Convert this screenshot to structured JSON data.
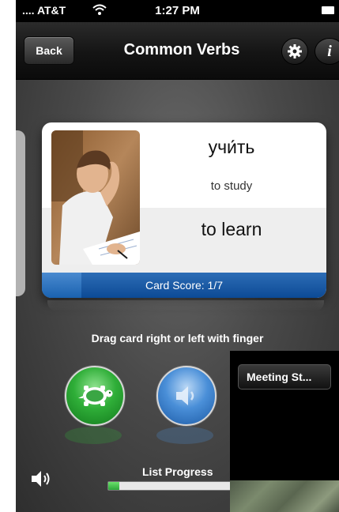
{
  "status_bar": {
    "carrier": "AT&T",
    "time": "1:27 PM"
  },
  "nav": {
    "back_label": "Back",
    "title": "Common Verbs",
    "info_label": "i"
  },
  "card": {
    "word_ru": "учи́ть",
    "transliteration": "to study",
    "word_en": "to learn",
    "score_text": "Card Score: 1/7",
    "score_fraction": 0.14
  },
  "hint": "Drag card right or left with finger",
  "controls": {
    "slow_button": "turtle-icon",
    "play_button": "speaker-icon"
  },
  "progress": {
    "label": "List Progress",
    "fraction": 0.09
  },
  "inset": {
    "back_label": "Meeting St..."
  },
  "colors": {
    "card_score_bar": "#0c4a96",
    "turtle_button": "#2fae38",
    "speaker_button": "#4a8fd8",
    "progress_fill": "#2da83a"
  }
}
